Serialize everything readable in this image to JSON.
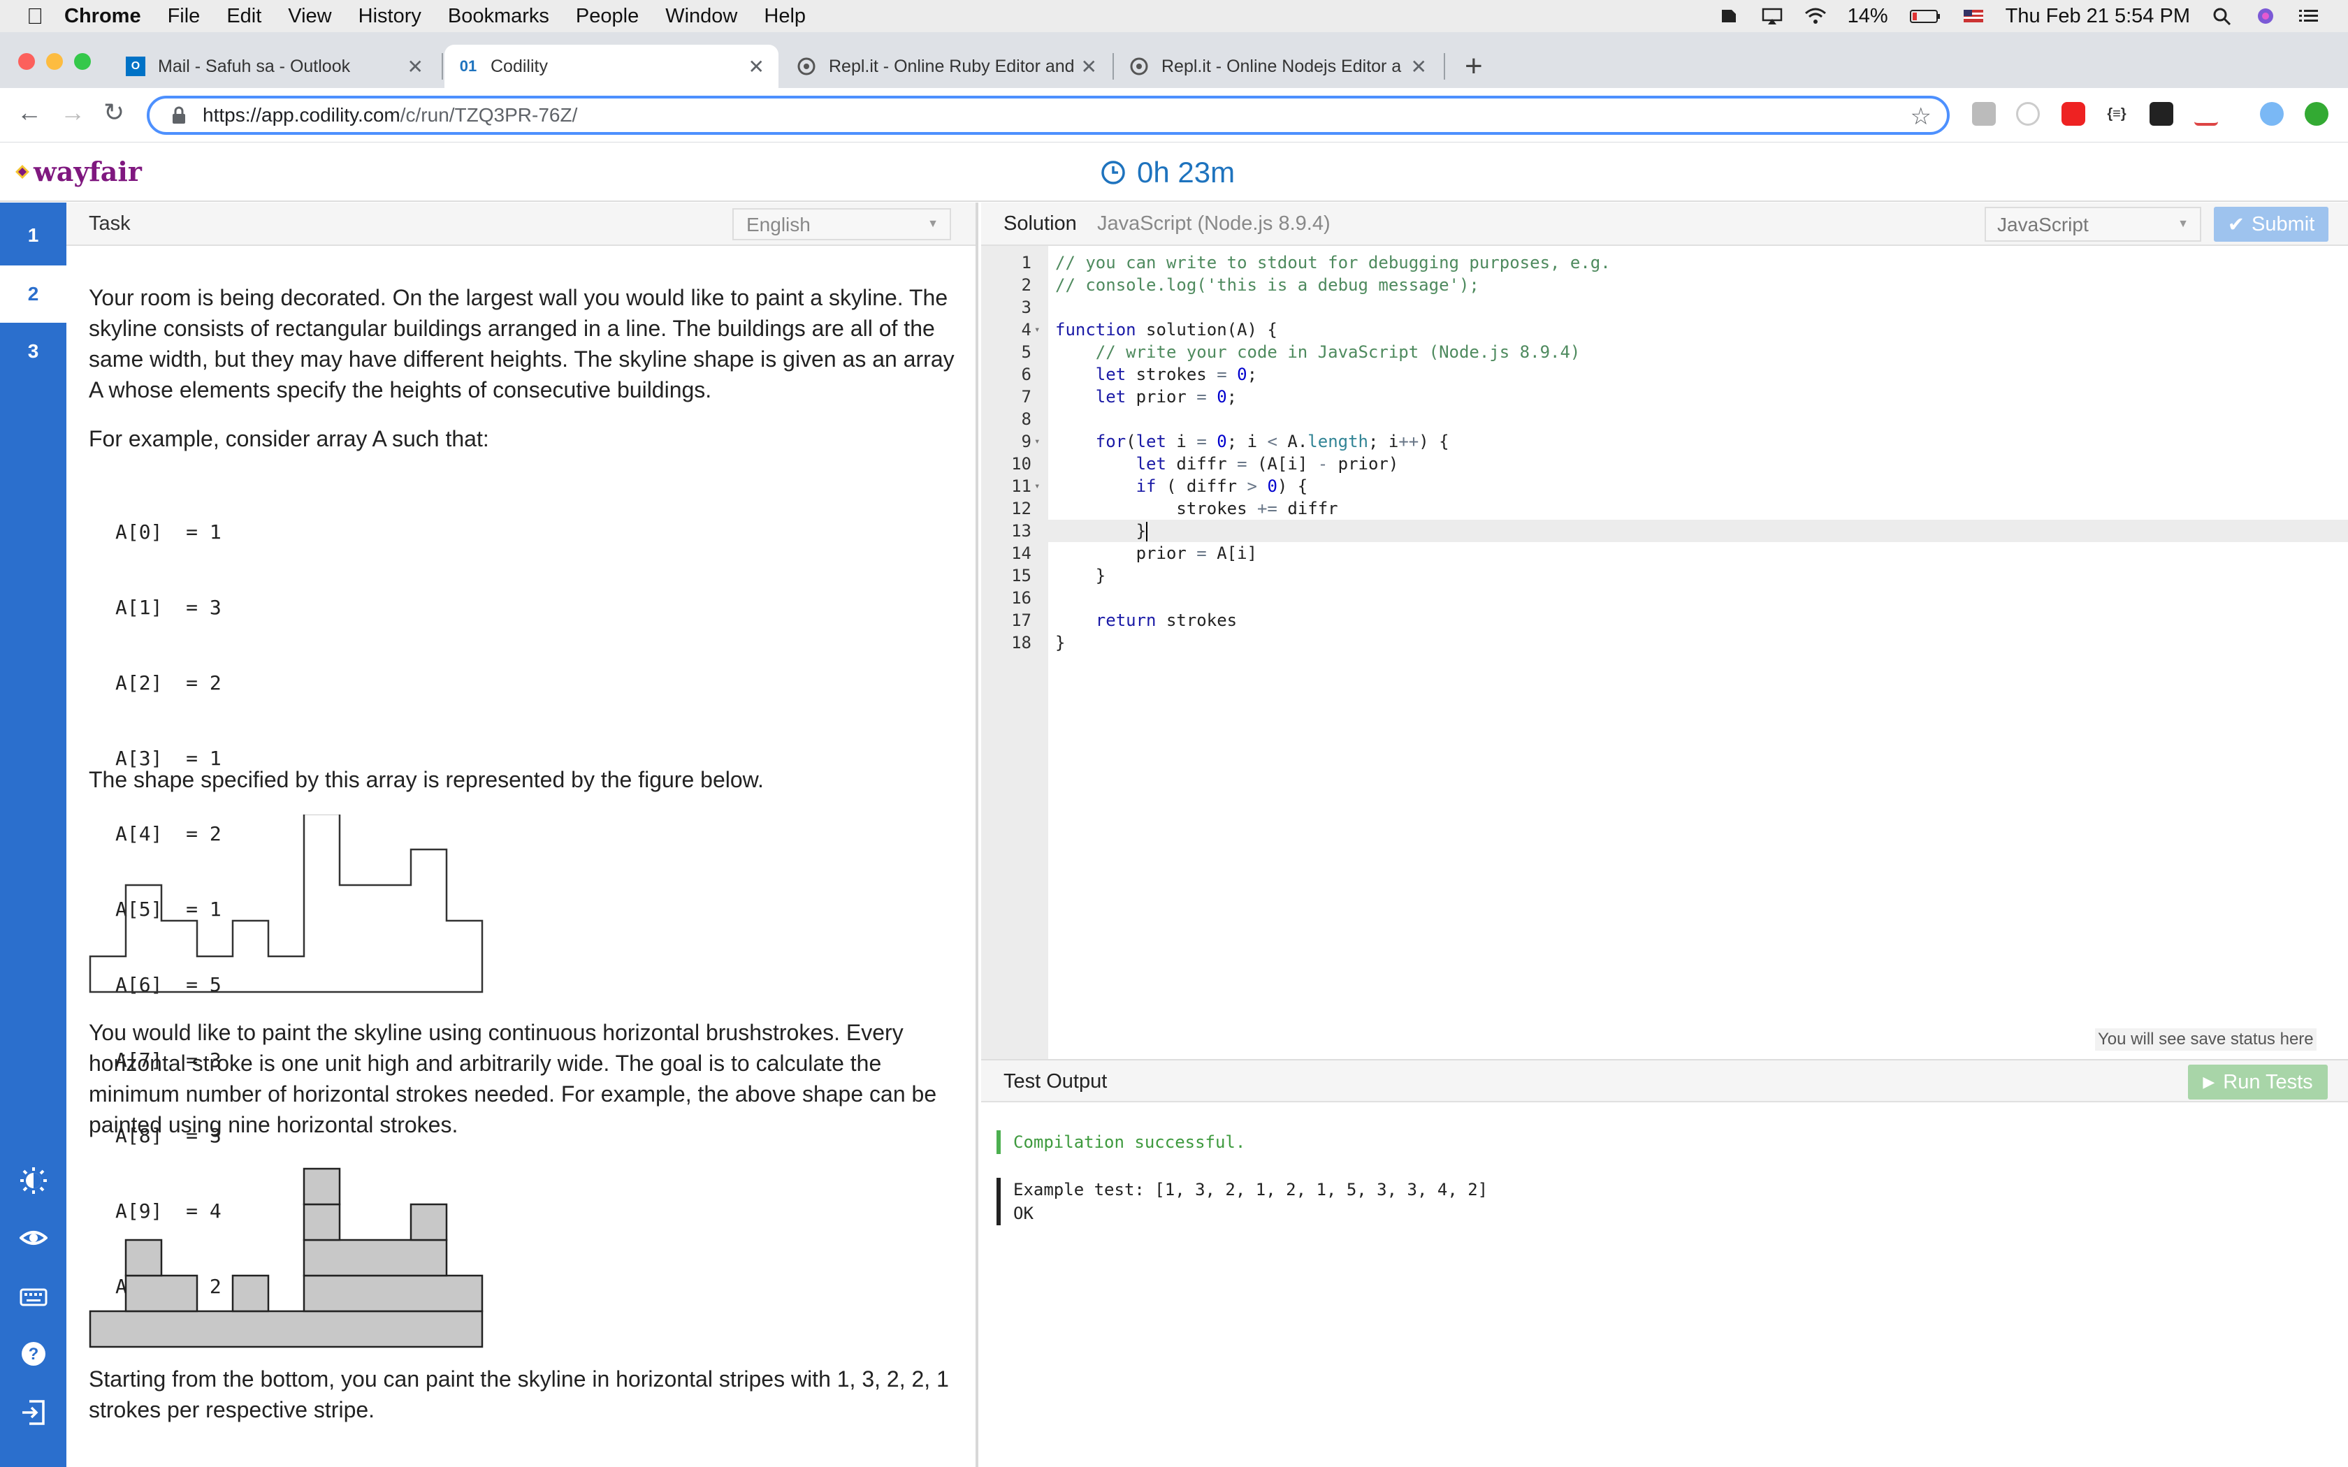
{
  "menubar": {
    "app": "Chrome",
    "items": [
      "File",
      "Edit",
      "View",
      "History",
      "Bookmarks",
      "People",
      "Window",
      "Help"
    ],
    "battery": "14%",
    "datetime": "Thu Feb 21  5:54 PM"
  },
  "tabs": [
    {
      "title": "Mail - Safuh sa - Outlook",
      "icon": "outlook-icon"
    },
    {
      "title": "Codility",
      "icon": "codility-icon",
      "favicon_text": "01"
    },
    {
      "title": "Repl.it - Online Ruby Editor and",
      "icon": "replit-icon"
    },
    {
      "title": "Repl.it - Online Nodejs Editor a",
      "icon": "replit-icon"
    }
  ],
  "address": {
    "host": "https://app.codility.com",
    "path": "/c/run/TZQ3PR-76Z/"
  },
  "header": {
    "logo": "wayfair",
    "timer": "0h 23m"
  },
  "rail": {
    "tasks": [
      "1",
      "2",
      "3"
    ]
  },
  "task": {
    "tab_label": "Task",
    "language": "English",
    "p1": "Your room is being decorated. On the largest wall you would like to paint a skyline. The skyline consists of rectangular buildings arranged in a line. The buildings are all of the same width, but they may have different heights. The skyline shape is given as an array A whose elements specify the heights of consecutive buildings.",
    "p2": "For example, consider array A such that:",
    "array_lines": [
      "A[0]  = 1",
      "A[1]  = 3",
      "A[2]  = 2",
      "A[3]  = 1",
      "A[4]  = 2",
      "A[5]  = 1",
      "A[6]  = 5",
      "A[7]  = 3",
      "A[8]  = 3",
      "A[9]  = 4",
      "A[10] = 2"
    ],
    "heights": [
      1,
      3,
      2,
      1,
      2,
      1,
      5,
      3,
      3,
      4,
      2
    ],
    "p3": "The shape specified by this array is represented by the figure below.",
    "p4": "You would like to paint the skyline using continuous horizontal brushstrokes. Every horizontal stroke is one unit high and arbitrarily wide. The goal is to calculate the minimum number of horizontal strokes needed. For example, the above shape can be painted using nine horizontal strokes.",
    "p5": "Starting from the bottom, you can paint the skyline in horizontal stripes with 1, 3, 2, 2, 1 strokes per respective stripe."
  },
  "solution": {
    "label": "Solution",
    "env": "JavaScript (Node.js 8.9.4)",
    "language": "JavaScript",
    "submit_label": "Submit",
    "save_status": "You will see save status here",
    "current_line": 13,
    "fold_lines": [
      4,
      9,
      11
    ],
    "code": [
      "// you can write to stdout for debugging purposes, e.g.",
      "// console.log('this is a debug message');",
      "",
      "function solution(A) {",
      "    // write your code in JavaScript (Node.js 8.9.4)",
      "    let strokes = 0;",
      "    let prior = 0;",
      "",
      "    for(let i = 0; i < A.length; i++) {",
      "        let diffr = (A[i] - prior)",
      "        if ( diffr > 0) {",
      "            strokes += diffr",
      "        }",
      "        prior = A[i]",
      "    }",
      "",
      "    return strokes",
      "}"
    ]
  },
  "test": {
    "label": "Test Output",
    "run_label": "Run Tests",
    "compile_msg": "Compilation successful.",
    "example_label": "Example test:   [1, 3, 2, 1, 2, 1, 5, 3, 3, 4, 2]",
    "result": "OK"
  },
  "colors": {
    "rail": "#2b6fcd",
    "timer": "#1e73be",
    "logo": "#7f187f",
    "submit": "#9ec3ee",
    "run": "#a8d5a8"
  }
}
